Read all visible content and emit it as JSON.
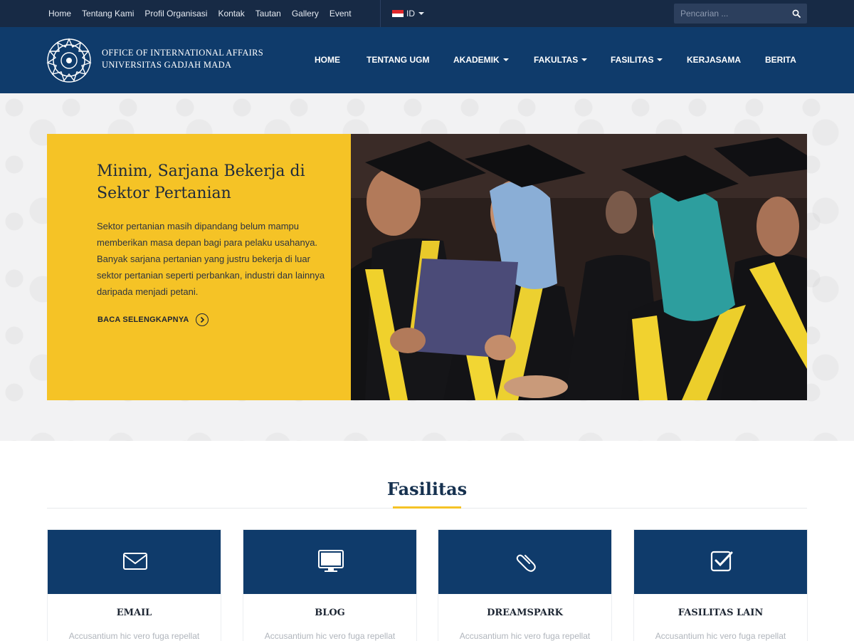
{
  "topbar": {
    "links": [
      "Home",
      "Tentang Kami",
      "Profil Organisasi",
      "Kontak",
      "Tautan",
      "Gallery",
      "Event"
    ],
    "language": "ID",
    "search_placeholder": "Pencarian ..."
  },
  "header": {
    "brand_line1": "Office of International Affairs",
    "brand_line2": "Universitas Gadjah Mada",
    "nav": [
      {
        "label": "HOME",
        "dropdown": false
      },
      {
        "label": "TENTANG UGM",
        "dropdown": false
      },
      {
        "label": "AKADEMIK",
        "dropdown": true
      },
      {
        "label": "FAKULTAS",
        "dropdown": true
      },
      {
        "label": "FASILITAS",
        "dropdown": true
      },
      {
        "label": "KERJASAMA",
        "dropdown": false
      },
      {
        "label": "BERITA",
        "dropdown": false
      }
    ]
  },
  "hero": {
    "title": "Minim, Sarjana Bekerja di Sektor Pertanian",
    "text": "Sektor pertanian masih dipandang belum mampu memberikan masa depan bagi para pelaku usahanya. Banyak sarjana pertanian yang justru bekerja di luar sektor pertanian seperti perbankan, industri dan lainnya daripada menjadi petani.",
    "read_more": "BACA SELENGKAPNYA"
  },
  "facilities": {
    "title": "Fasilitas",
    "items": [
      {
        "name": "EMAIL",
        "icon": "envelope-icon",
        "desc": "Accusantium hic vero fuga repellat"
      },
      {
        "name": "BLOG",
        "icon": "monitor-icon",
        "desc": "Accusantium hic vero fuga repellat"
      },
      {
        "name": "DREAMSPARK",
        "icon": "paperclip-icon",
        "desc": "Accusantium hic vero fuga repellat"
      },
      {
        "name": "FASILITAS LAIN",
        "icon": "checkbox-icon",
        "desc": "Accusantium hic vero fuga repellat"
      }
    ]
  },
  "colors": {
    "topbar": "#172a45",
    "header": "#0f3b6b",
    "accent_yellow": "#f5c326"
  }
}
